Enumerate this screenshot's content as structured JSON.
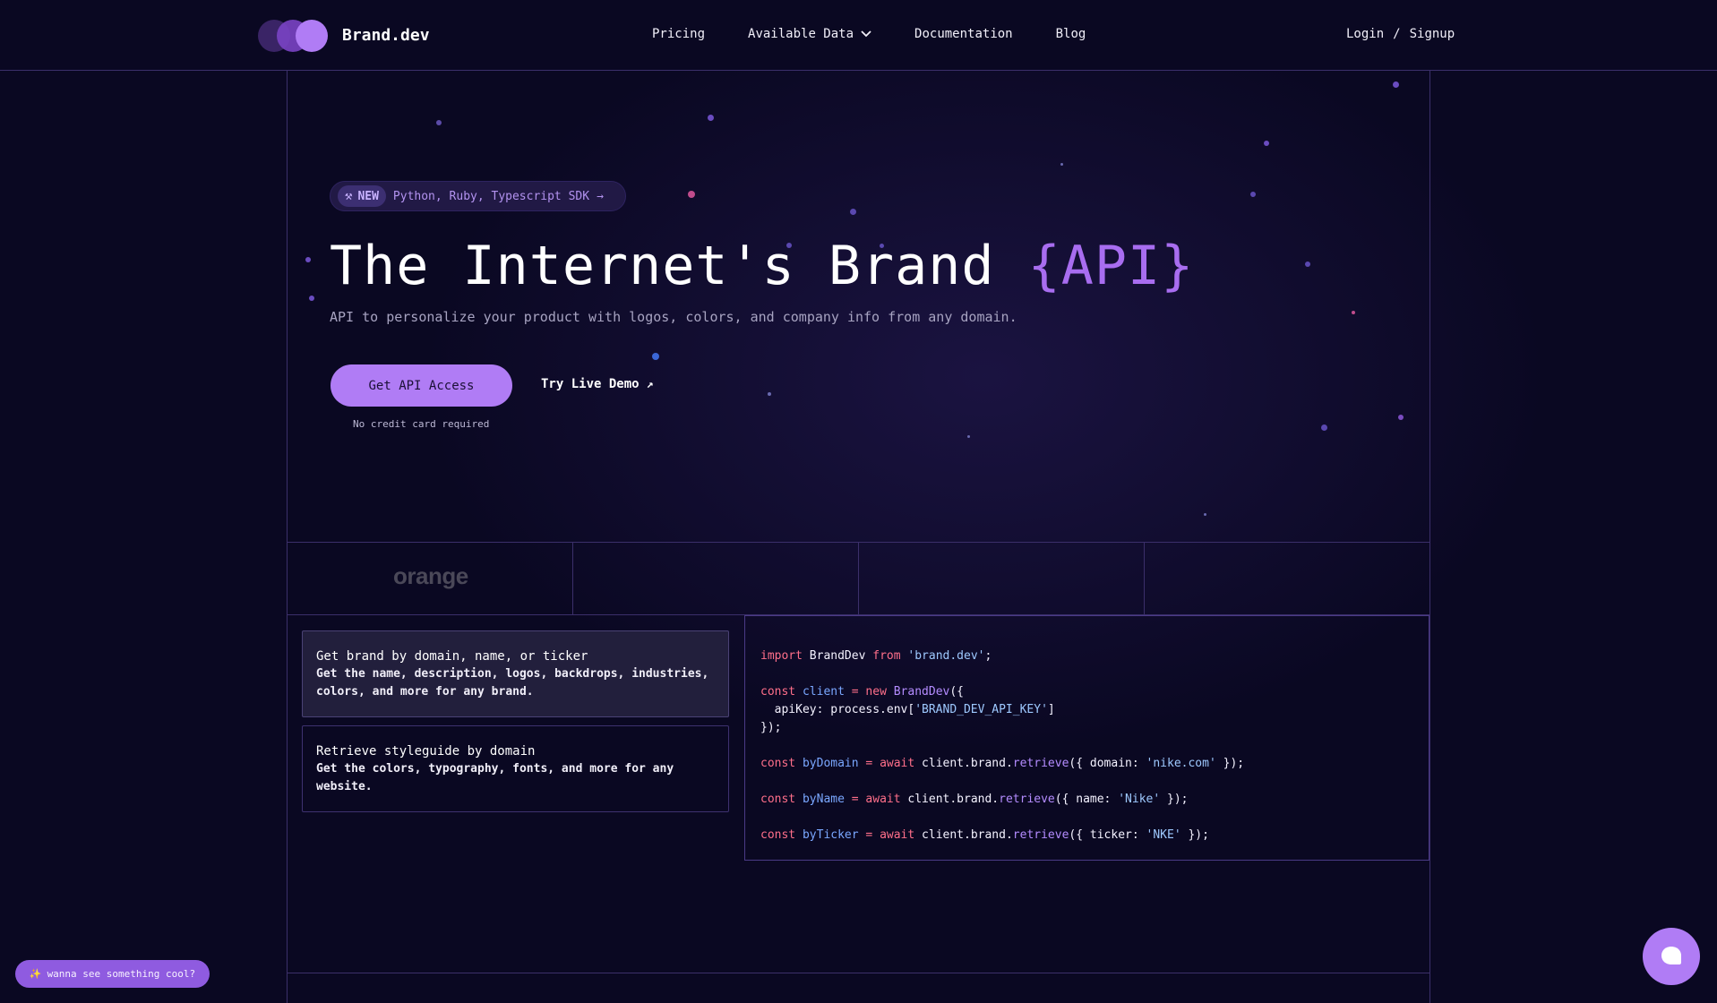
{
  "nav": {
    "brand": "Brand.dev",
    "links": [
      "Pricing",
      "Available Data",
      "Documentation",
      "Blog"
    ],
    "login": "Login",
    "separator": "/",
    "signup": "Signup"
  },
  "hero": {
    "badge_new": "NEW",
    "badge_text": "Python, Ruby, Typescript SDK",
    "badge_arrow": "→",
    "headline_main": "The Internet's Brand ",
    "headline_accent": "{API}",
    "subtitle": "API to personalize your product with logos, colors, and company info from any domain.",
    "cta_label": "Get API Access",
    "demo_label": "Try Live Demo",
    "demo_arrow": "↗",
    "note": "No credit card required"
  },
  "logos": {
    "first": "orange"
  },
  "features": [
    {
      "title": "Get brand by domain, name, or ticker",
      "desc": "Get the name, description, logos, backdrops, industries, colors, and more for any brand."
    },
    {
      "title": "Retrieve styleguide by domain",
      "desc": "Get the colors, typography, fonts, and more for any website."
    }
  ],
  "code": {
    "l1_kw": "import",
    "l1_a": " BrandDev ",
    "l1_kw2": "from",
    "l1_str": " 'brand.dev'",
    "l1_end": ";",
    "l2_kw": "const",
    "l2_var": " client",
    "l2_eq": " = ",
    "l2_kw2": "new",
    "l2_fn": " BrandDev",
    "l2_end": "({",
    "l3_a": "  apiKey: process.env[",
    "l3_str": "'BRAND_DEV_API_KEY'",
    "l3_end": "]",
    "l4": "});",
    "l5_kw": "const",
    "l5_var": " byDomain",
    "l5_eq": " = ",
    "l5_kw2": "await",
    "l5_a": " client.brand.",
    "l5_fn": "retrieve",
    "l5_b": "({ domain: ",
    "l5_str": "'nike.com'",
    "l5_end": " });",
    "l6_kw": "const",
    "l6_var": " byName",
    "l6_eq": " = ",
    "l6_kw2": "await",
    "l6_a": " client.brand.",
    "l6_fn": "retrieve",
    "l6_b": "({ name: ",
    "l6_str": "'Nike'",
    "l6_end": " });",
    "l7_kw": "const",
    "l7_var": " byTicker",
    "l7_eq": " = ",
    "l7_kw2": "await",
    "l7_a": " client.brand.",
    "l7_fn": "retrieve",
    "l7_b": "({ ticker: ",
    "l7_str": "'NKE'",
    "l7_end": " });"
  },
  "widgets": {
    "cool_icon": "sparkle-icon",
    "cool_label": "wanna see something cool?",
    "chat_icon": "chat-bubble-icon"
  },
  "colors": {
    "background": "#0a0822",
    "accent": "#b07cf5",
    "border": "#3b2f6a"
  }
}
